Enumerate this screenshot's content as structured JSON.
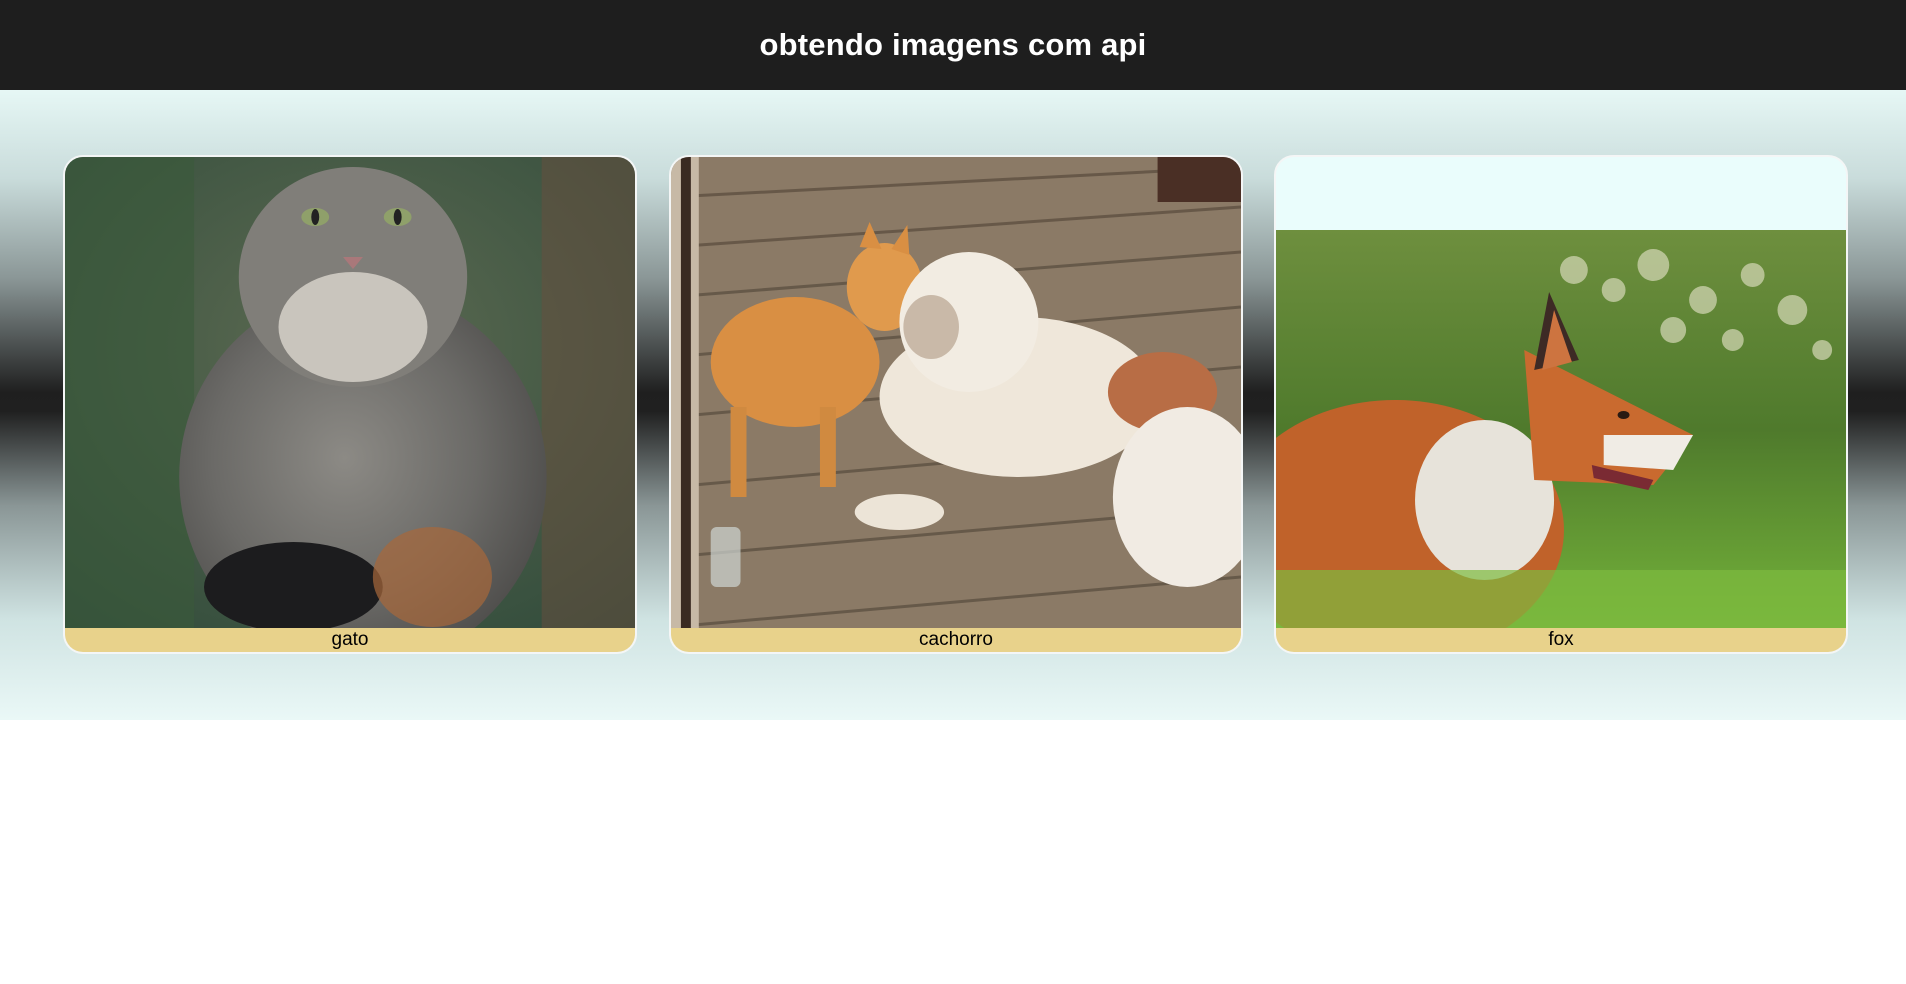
{
  "header": {
    "title": "obtendo imagens com api"
  },
  "cards": [
    {
      "caption": "gato",
      "image": "pallas-cat-photo"
    },
    {
      "caption": "cachorro",
      "image": "cat-and-bulldog-photo"
    },
    {
      "caption": "fox",
      "image": "red-fox-photo"
    }
  ],
  "colors": {
    "header_bg": "#1e1e1e",
    "caption_bg": "#e8d28b",
    "card_bg": "#eafdfc"
  }
}
